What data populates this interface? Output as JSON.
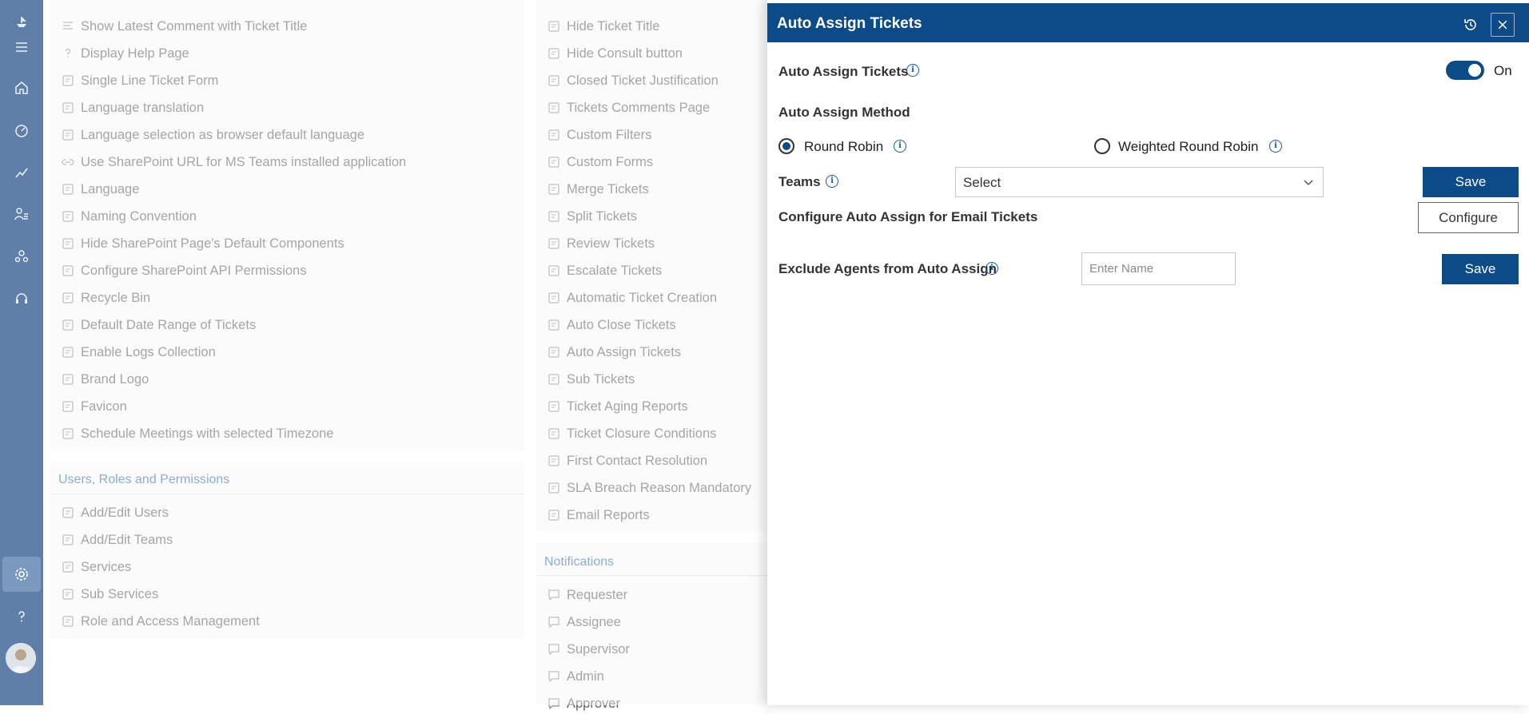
{
  "general_items": [
    {
      "label": "Show Latest Comment with Ticket Title",
      "icon": "lines-icon"
    },
    {
      "label": "Display Help Page",
      "icon": "question-icon"
    },
    {
      "label": "Single Line Ticket Form",
      "icon": "form-edit-icon"
    },
    {
      "label": "Language translation",
      "icon": "translate-icon"
    },
    {
      "label": "Language selection as browser default language",
      "icon": "people-language-icon"
    },
    {
      "label": "Use SharePoint URL for MS Teams installed application",
      "icon": "link-icon"
    },
    {
      "label": "Language",
      "icon": "people-language-icon"
    },
    {
      "label": "Naming Convention",
      "icon": "naming-icon"
    },
    {
      "label": "Hide SharePoint Page's Default Components",
      "icon": "page-icon"
    },
    {
      "label": "Configure SharePoint API Permissions",
      "icon": "api-icon"
    },
    {
      "label": "Recycle Bin",
      "icon": "recycle-bin-icon"
    },
    {
      "label": "Default Date Range of Tickets",
      "icon": "calendar-icon"
    },
    {
      "label": "Enable Logs Collection",
      "icon": "history-icon"
    },
    {
      "label": "Brand Logo",
      "icon": "badge-icon"
    },
    {
      "label": "Favicon",
      "icon": "favicon-icon"
    },
    {
      "label": "Schedule Meetings with selected Timezone",
      "icon": "globe-people-icon"
    }
  ],
  "users_section": {
    "title": "Users, Roles and Permissions",
    "items": [
      {
        "label": "Add/Edit Users",
        "icon": "users-icon"
      },
      {
        "label": "Add/Edit Teams",
        "icon": "teams-icon"
      },
      {
        "label": "Services",
        "icon": "list-icon"
      },
      {
        "label": "Sub Services",
        "icon": "sub-list-icon"
      },
      {
        "label": "Role and Access Management",
        "icon": "key-icon"
      }
    ]
  },
  "ticket_items": [
    {
      "label": "Hide Ticket Title",
      "icon": "ellipsis-box-icon"
    },
    {
      "label": "Hide Consult button",
      "icon": "consult-icon"
    },
    {
      "label": "Closed Ticket Justification",
      "icon": "edit-box-icon"
    },
    {
      "label": "Tickets Comments Page",
      "icon": "comments-page-icon"
    },
    {
      "label": "Custom Filters",
      "icon": "filter-icon"
    },
    {
      "label": "Custom Forms",
      "icon": "layers-icon"
    },
    {
      "label": "Merge Tickets",
      "icon": "merge-icon"
    },
    {
      "label": "Split Tickets",
      "icon": "split-icon"
    },
    {
      "label": "Review Tickets",
      "icon": "review-icon"
    },
    {
      "label": "Escalate Tickets",
      "icon": "escalate-icon"
    },
    {
      "label": "Automatic Ticket Creation",
      "icon": "mail-auto-icon"
    },
    {
      "label": "Auto Close Tickets",
      "icon": "auto-close-icon"
    },
    {
      "label": "Auto Assign Tickets",
      "icon": "clipboard-icon"
    },
    {
      "label": "Sub Tickets",
      "icon": "sub-tickets-icon"
    },
    {
      "label": "Ticket Aging Reports",
      "icon": "square-icon"
    },
    {
      "label": "Ticket Closure Conditions",
      "icon": "clipboard-check-icon"
    },
    {
      "label": "First Contact Resolution",
      "icon": "headset-icon"
    },
    {
      "label": "SLA Breach Reason Mandatory",
      "icon": "doc-list-icon"
    },
    {
      "label": "Email Reports",
      "icon": "chart-line-icon"
    }
  ],
  "notifications_section": {
    "title": "Notifications",
    "items": [
      {
        "label": "Requester",
        "icon": "chat-icon"
      },
      {
        "label": "Assignee",
        "icon": "chat-icon"
      },
      {
        "label": "Supervisor",
        "icon": "chat-icon"
      },
      {
        "label": "Admin",
        "icon": "chat-icon"
      },
      {
        "label": "Approver",
        "icon": "chat-icon"
      }
    ]
  },
  "drawer": {
    "title": "Auto Assign Tickets",
    "auto_assign_label": "Auto Assign Tickets",
    "toggle_state": "On",
    "method_label": "Auto Assign Method",
    "method_options": [
      "Round Robin",
      "Weighted Round Robin"
    ],
    "selected_method": "Round Robin",
    "teams_label": "Teams",
    "teams_select_value": "Select",
    "save_label": "Save",
    "email_label": "Configure Auto Assign for Email Tickets",
    "configure_label": "Configure",
    "exclude_label": "Exclude Agents from Auto Assign",
    "exclude_placeholder": "Enter Name",
    "save_label_2": "Save"
  },
  "colors": {
    "rail": "#5f7fa8",
    "header": "#0c4a88",
    "section_title": "#2e6aa8"
  }
}
